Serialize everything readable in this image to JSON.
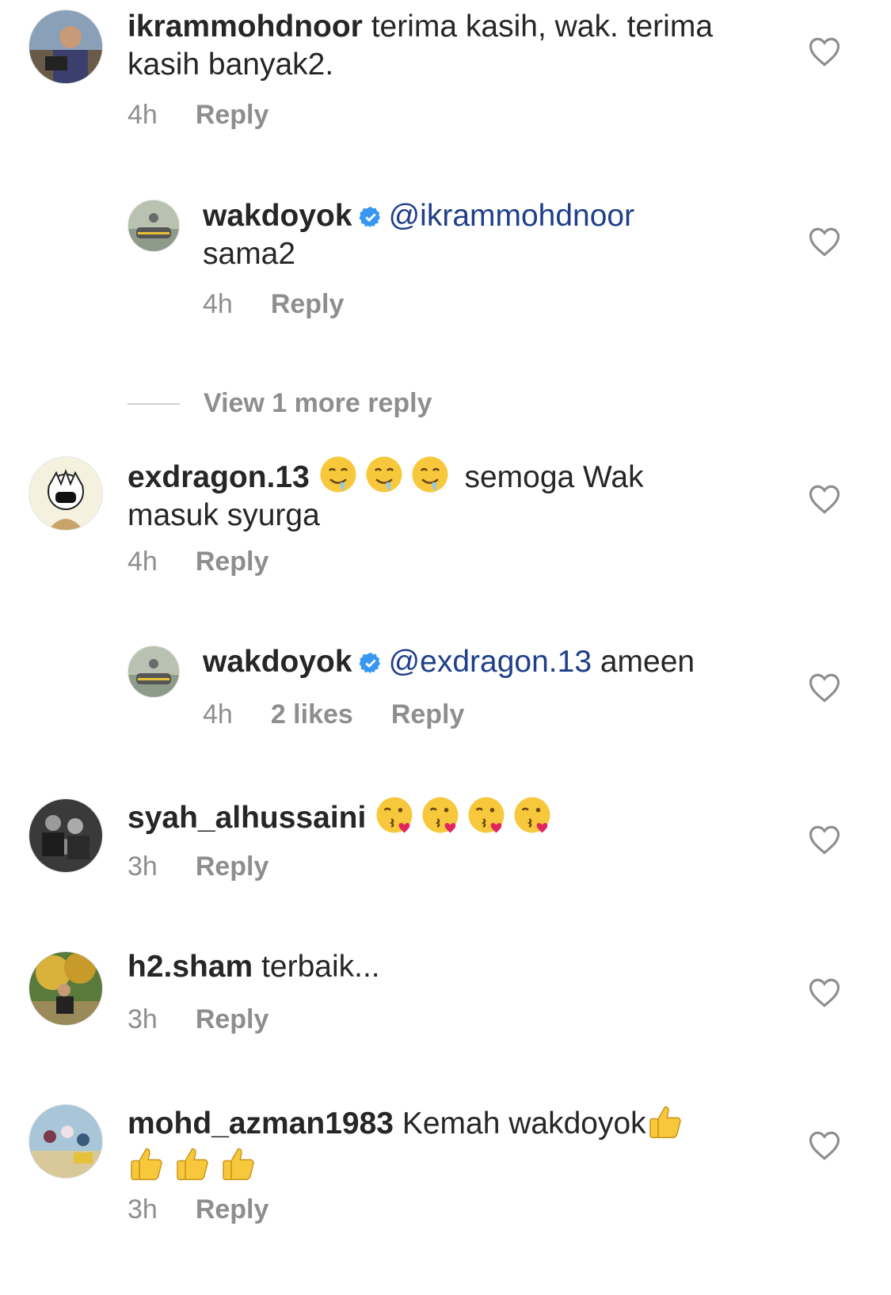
{
  "comments": [
    {
      "username": "ikrammohdnoor",
      "text": "terima kasih, wak. terima kasih banyak2.",
      "time": "4h",
      "reply_label": "Reply"
    },
    {
      "username": "wakdoyok",
      "mention": "@ikrammohdnoor",
      "text": "sama2",
      "time": "4h",
      "reply_label": "Reply"
    },
    {
      "username": "exdragon.13",
      "emoji": "drooling-face",
      "text": "semoga Wak masuk syurga",
      "time": "4h",
      "reply_label": "Reply"
    },
    {
      "username": "wakdoyok",
      "mention": "@exdragon.13",
      "text": "ameen",
      "time": "4h",
      "likes": "2 likes",
      "reply_label": "Reply"
    },
    {
      "username": "syah_alhussaini",
      "emoji": "face-blowing-kiss",
      "time": "3h",
      "reply_label": "Reply"
    },
    {
      "username": "h2.sham",
      "text": "terbaik...",
      "time": "3h",
      "reply_label": "Reply"
    },
    {
      "username": "mohd_azman1983",
      "text": "Kemah wakdoyok",
      "emoji": "thumbs-up",
      "time": "3h",
      "reply_label": "Reply"
    }
  ],
  "view_more_replies": "View 1 more reply",
  "icons": {
    "like": "heart-outline-icon",
    "verified": "verified-badge-icon"
  },
  "colors": {
    "text": "#262626",
    "muted": "#8e8e8e",
    "mention": "#1f3f8a",
    "verified": "#3897f0"
  }
}
